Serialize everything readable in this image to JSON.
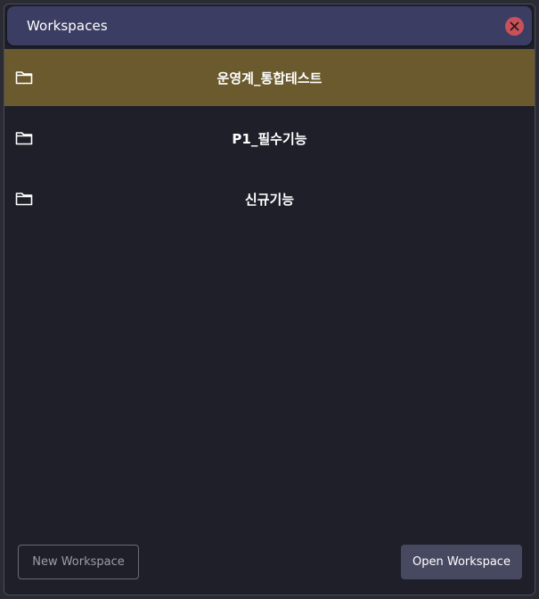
{
  "dialog": {
    "title": "Workspaces",
    "close_icon": "close-icon"
  },
  "workspaces": [
    {
      "label": "운영계_통합테스트",
      "icon": "folder-icon",
      "selected": true
    },
    {
      "label": "P1_필수기능",
      "icon": "folder-icon",
      "selected": false
    },
    {
      "label": "신규기능",
      "icon": "folder-icon",
      "selected": false
    }
  ],
  "footer": {
    "new_label": "New Workspace",
    "open_label": "Open Workspace"
  },
  "colors": {
    "titlebar": "#3c3d63",
    "background": "#1e1f29",
    "selected_row": "#6b5a2d",
    "close_button": "#c9525a",
    "primary_button": "#474960"
  }
}
